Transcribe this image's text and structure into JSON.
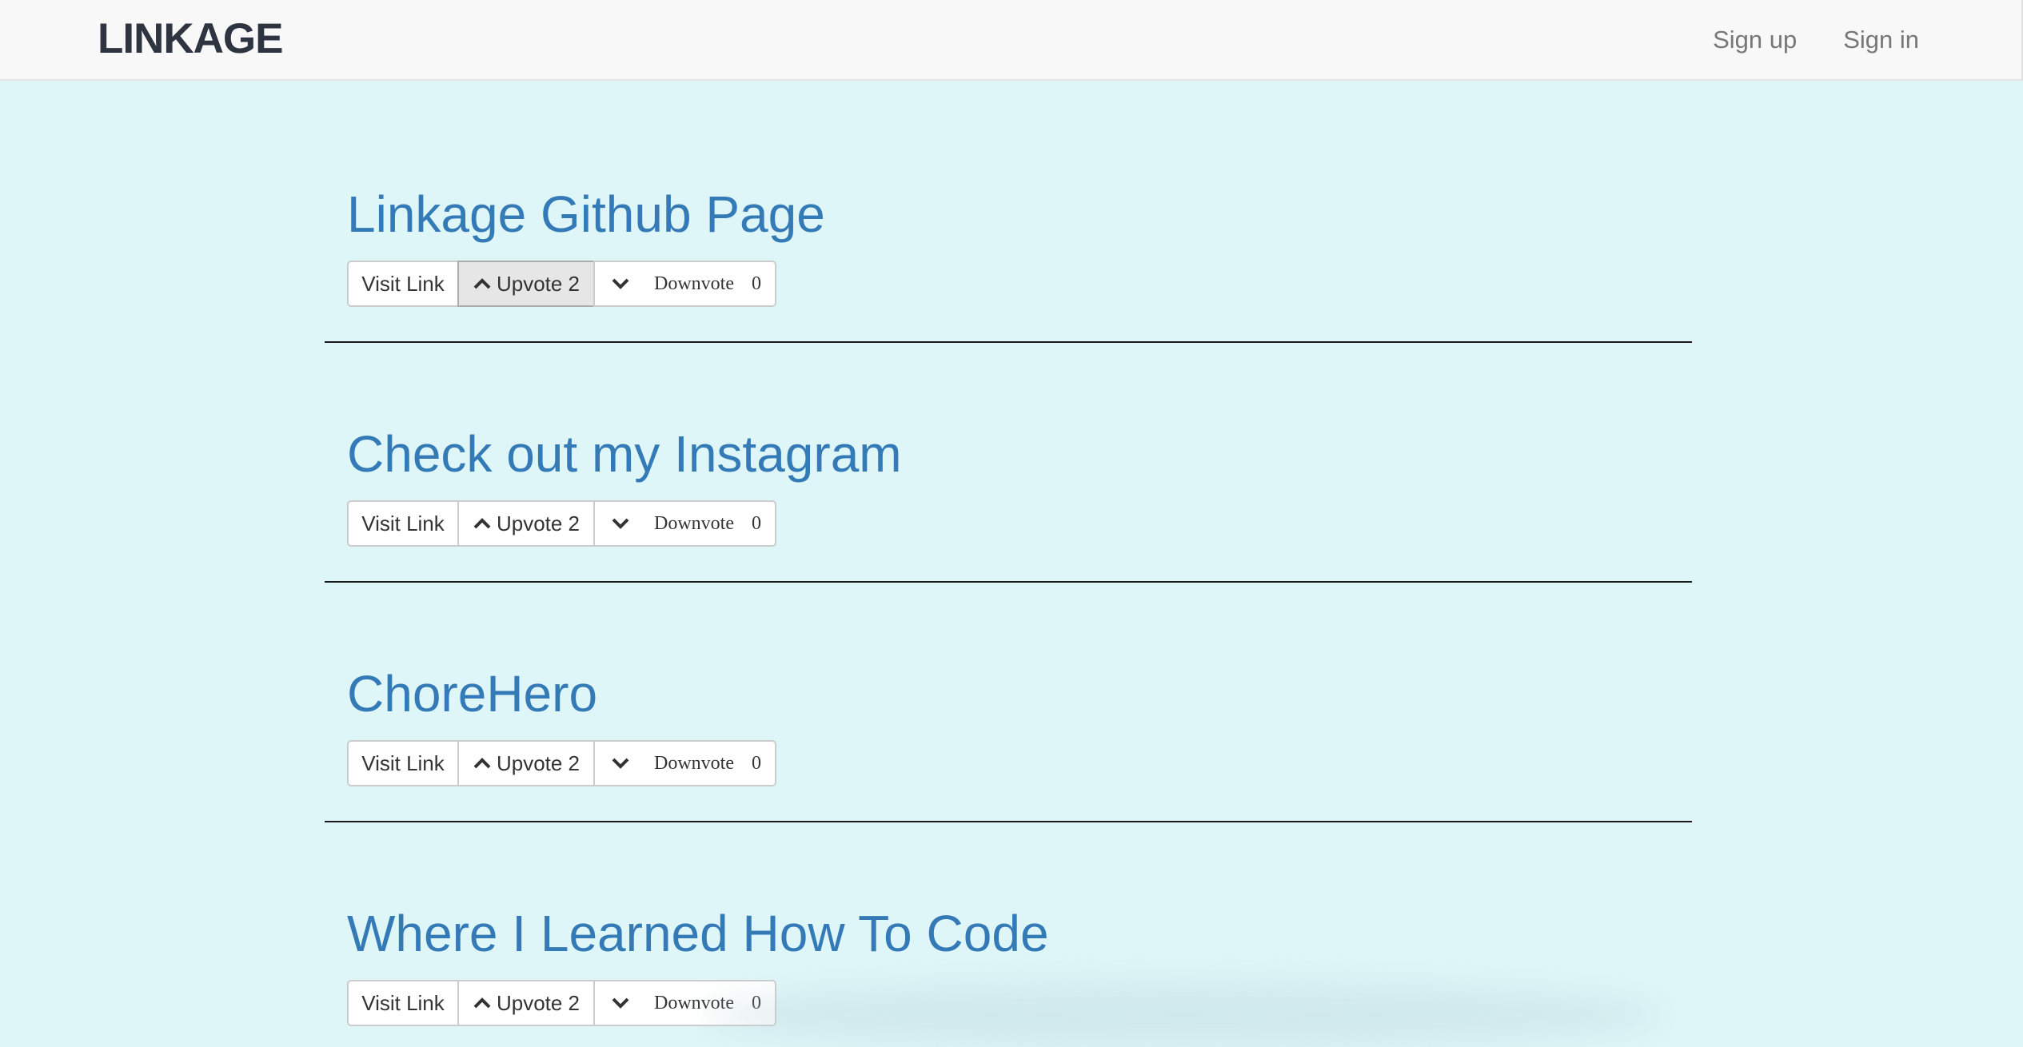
{
  "navbar": {
    "brand": "LINKAGE",
    "links": [
      {
        "label": "Sign up"
      },
      {
        "label": "Sign in"
      }
    ]
  },
  "posts": [
    {
      "title": "Linkage Github Page",
      "visit_label": "Visit Link",
      "upvote_label": "Upvote 2",
      "downvote_label": "Downvote",
      "downvote_count": "0",
      "upvote_active": true
    },
    {
      "title": "Check out my Instagram",
      "visit_label": "Visit Link",
      "upvote_label": "Upvote 2",
      "downvote_label": "Downvote",
      "downvote_count": "0",
      "upvote_active": false
    },
    {
      "title": "ChoreHero",
      "visit_label": "Visit Link",
      "upvote_label": "Upvote 2",
      "downvote_label": "Downvote",
      "downvote_count": "0",
      "upvote_active": false
    },
    {
      "title": "Where I Learned How To Code",
      "visit_label": "Visit Link",
      "upvote_label": "Upvote 2",
      "downvote_label": "Downvote",
      "downvote_count": "0",
      "upvote_active": false
    }
  ],
  "icons": {
    "upvote": "chevron-up-icon",
    "downvote": "chevron-down-icon"
  },
  "colors": {
    "page_background": "#dff6f8",
    "navbar_background": "#f8f8f8",
    "brand": "#2e3440",
    "title_link": "#337ab7",
    "nav_link": "#777777"
  }
}
